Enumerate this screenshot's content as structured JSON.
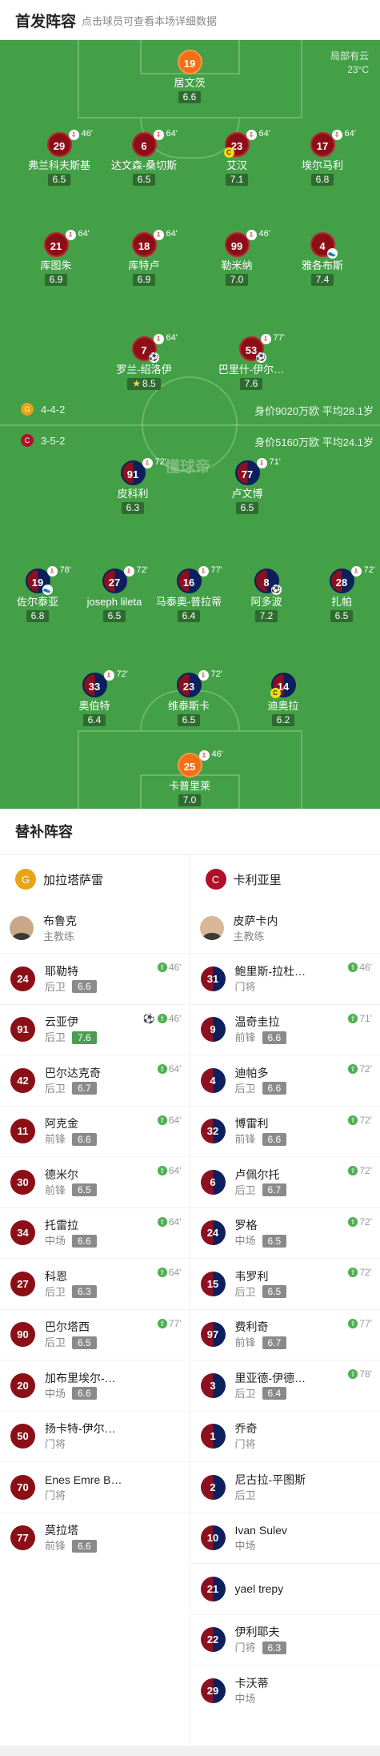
{
  "header": {
    "title": "首发阵容",
    "subtitle": "点击球员可查看本场详细数据"
  },
  "weather": {
    "line1": "局部有云",
    "line2": "23°C"
  },
  "watermark": "懂球帝",
  "home": {
    "formation": "4-4-2",
    "value": "身价9020万欧 平均28.1岁",
    "players": [
      {
        "num": "19",
        "name": "居文茨",
        "rating": "6.6",
        "gk": true
      },
      {
        "num": "29",
        "name": "弗兰科夫斯基",
        "rating": "6.5",
        "sub": "46'"
      },
      {
        "num": "6",
        "name": "达文森-桑切斯",
        "rating": "6.5",
        "sub": "64'"
      },
      {
        "num": "23",
        "name": "艾汉",
        "rating": "7.1",
        "sub": "64'",
        "cap": true
      },
      {
        "num": "17",
        "name": "埃尔马利",
        "rating": "6.8",
        "sub": "64'"
      },
      {
        "num": "21",
        "name": "库图朱",
        "rating": "6.9",
        "sub": "64'"
      },
      {
        "num": "18",
        "name": "库特卢",
        "rating": "6.9",
        "sub": "64'"
      },
      {
        "num": "99",
        "name": "勒米纳",
        "rating": "7.0",
        "sub": "46'"
      },
      {
        "num": "4",
        "name": "雅各布斯",
        "rating": "7.4",
        "assist": true
      },
      {
        "num": "7",
        "name": "罗兰-绍洛伊",
        "rating": "8.5",
        "sub": "64'",
        "ball": true,
        "star": true
      },
      {
        "num": "53",
        "name": "巴里什-伊尔…",
        "rating": "7.6",
        "sub": "77'",
        "ball": true
      }
    ]
  },
  "away": {
    "formation": "3-5-2",
    "value": "身价5160万欧 平均24.1岁",
    "players": [
      {
        "num": "91",
        "name": "皮科利",
        "rating": "6.3",
        "sub": "72'"
      },
      {
        "num": "77",
        "name": "卢文博",
        "rating": "6.5",
        "sub": "71'"
      },
      {
        "num": "19",
        "name": "佐尔泰亚",
        "rating": "6.8",
        "sub": "78'",
        "assist": true
      },
      {
        "num": "27",
        "name": "joseph lileta",
        "rating": "6.5",
        "sub": "72'"
      },
      {
        "num": "16",
        "name": "马泰奥-普拉蒂",
        "rating": "6.4",
        "sub": "77'"
      },
      {
        "num": "8",
        "name": "阿多波",
        "rating": "7.2",
        "ball": true
      },
      {
        "num": "28",
        "name": "扎帕",
        "rating": "6.5",
        "sub": "72'"
      },
      {
        "num": "33",
        "name": "奥伯特",
        "rating": "6.4",
        "sub": "72'"
      },
      {
        "num": "23",
        "name": "维泰斯卡",
        "rating": "6.5",
        "sub": "72'"
      },
      {
        "num": "14",
        "name": "迪奥拉",
        "rating": "6.2",
        "cap": true
      },
      {
        "num": "25",
        "name": "卡普里莱",
        "rating": "7.0",
        "sub": "46'",
        "gk": true
      }
    ]
  },
  "bench": {
    "title": "替补阵容",
    "home": {
      "team": "加拉塔萨雷",
      "coach": {
        "name": "布鲁克",
        "role": "主教练"
      },
      "players": [
        {
          "num": "24",
          "name": "耶勒特",
          "pos": "后卫",
          "rating": "6.6",
          "in": "46'"
        },
        {
          "num": "91",
          "name": "云亚伊",
          "pos": "后卫",
          "rating": "7.6",
          "in": "46'",
          "ball": true,
          "hi": true
        },
        {
          "num": "42",
          "name": "巴尔达克奇",
          "pos": "后卫",
          "rating": "6.7",
          "in": "64'"
        },
        {
          "num": "11",
          "name": "阿克金",
          "pos": "前锋",
          "rating": "6.6",
          "in": "64'"
        },
        {
          "num": "30",
          "name": "德米尔",
          "pos": "前锋",
          "rating": "6.5",
          "in": "64'"
        },
        {
          "num": "34",
          "name": "托雷拉",
          "pos": "中场",
          "rating": "6.6",
          "in": "64'"
        },
        {
          "num": "27",
          "name": "科恩",
          "pos": "后卫",
          "rating": "6.3",
          "in": "64'"
        },
        {
          "num": "90",
          "name": "巴尔塔西",
          "pos": "后卫",
          "rating": "6.5",
          "in": "77'"
        },
        {
          "num": "20",
          "name": "加布里埃尔-…",
          "pos": "中场",
          "rating": "6.6"
        },
        {
          "num": "50",
          "name": "扬卡特-伊尔…",
          "pos": "门将"
        },
        {
          "num": "70",
          "name": "Enes Emre B…",
          "pos": "门将"
        },
        {
          "num": "77",
          "name": "莫拉塔",
          "pos": "前锋",
          "rating": "6.6"
        }
      ]
    },
    "away": {
      "team": "卡利亚里",
      "coach": {
        "name": "皮萨卡内",
        "role": "主教练"
      },
      "players": [
        {
          "num": "31",
          "name": "鲍里斯-拉杜…",
          "pos": "门将",
          "in": "46'"
        },
        {
          "num": "9",
          "name": "温奇圭拉",
          "pos": "前锋",
          "rating": "6.6",
          "in": "71'"
        },
        {
          "num": "4",
          "name": "迪帕多",
          "pos": "后卫",
          "rating": "6.6",
          "in": "72'"
        },
        {
          "num": "32",
          "name": "博雷利",
          "pos": "前锋",
          "rating": "6.6",
          "in": "72'"
        },
        {
          "num": "6",
          "name": "卢佩尔托",
          "pos": "后卫",
          "rating": "6.7",
          "in": "72'"
        },
        {
          "num": "24",
          "name": "罗格",
          "pos": "中场",
          "rating": "6.5",
          "in": "72'"
        },
        {
          "num": "15",
          "name": "韦罗利",
          "pos": "后卫",
          "rating": "6.5",
          "in": "72'"
        },
        {
          "num": "97",
          "name": "费利奇",
          "pos": "前锋",
          "rating": "6.7",
          "in": "77'"
        },
        {
          "num": "3",
          "name": "里亚德-伊德…",
          "pos": "后卫",
          "rating": "6.4",
          "in": "78'"
        },
        {
          "num": "1",
          "name": "乔奇",
          "pos": "门将"
        },
        {
          "num": "2",
          "name": "尼古拉-平图斯",
          "pos": "后卫"
        },
        {
          "num": "10",
          "name": "Ivan Sulev",
          "pos": "中场"
        },
        {
          "num": "21",
          "name": "yael trepy",
          "pos": ""
        },
        {
          "num": "22",
          "name": "伊利耶夫",
          "pos": "门将",
          "rating": "6.3"
        },
        {
          "num": "29",
          "name": "卡沃蒂",
          "pos": "中场"
        }
      ]
    }
  }
}
